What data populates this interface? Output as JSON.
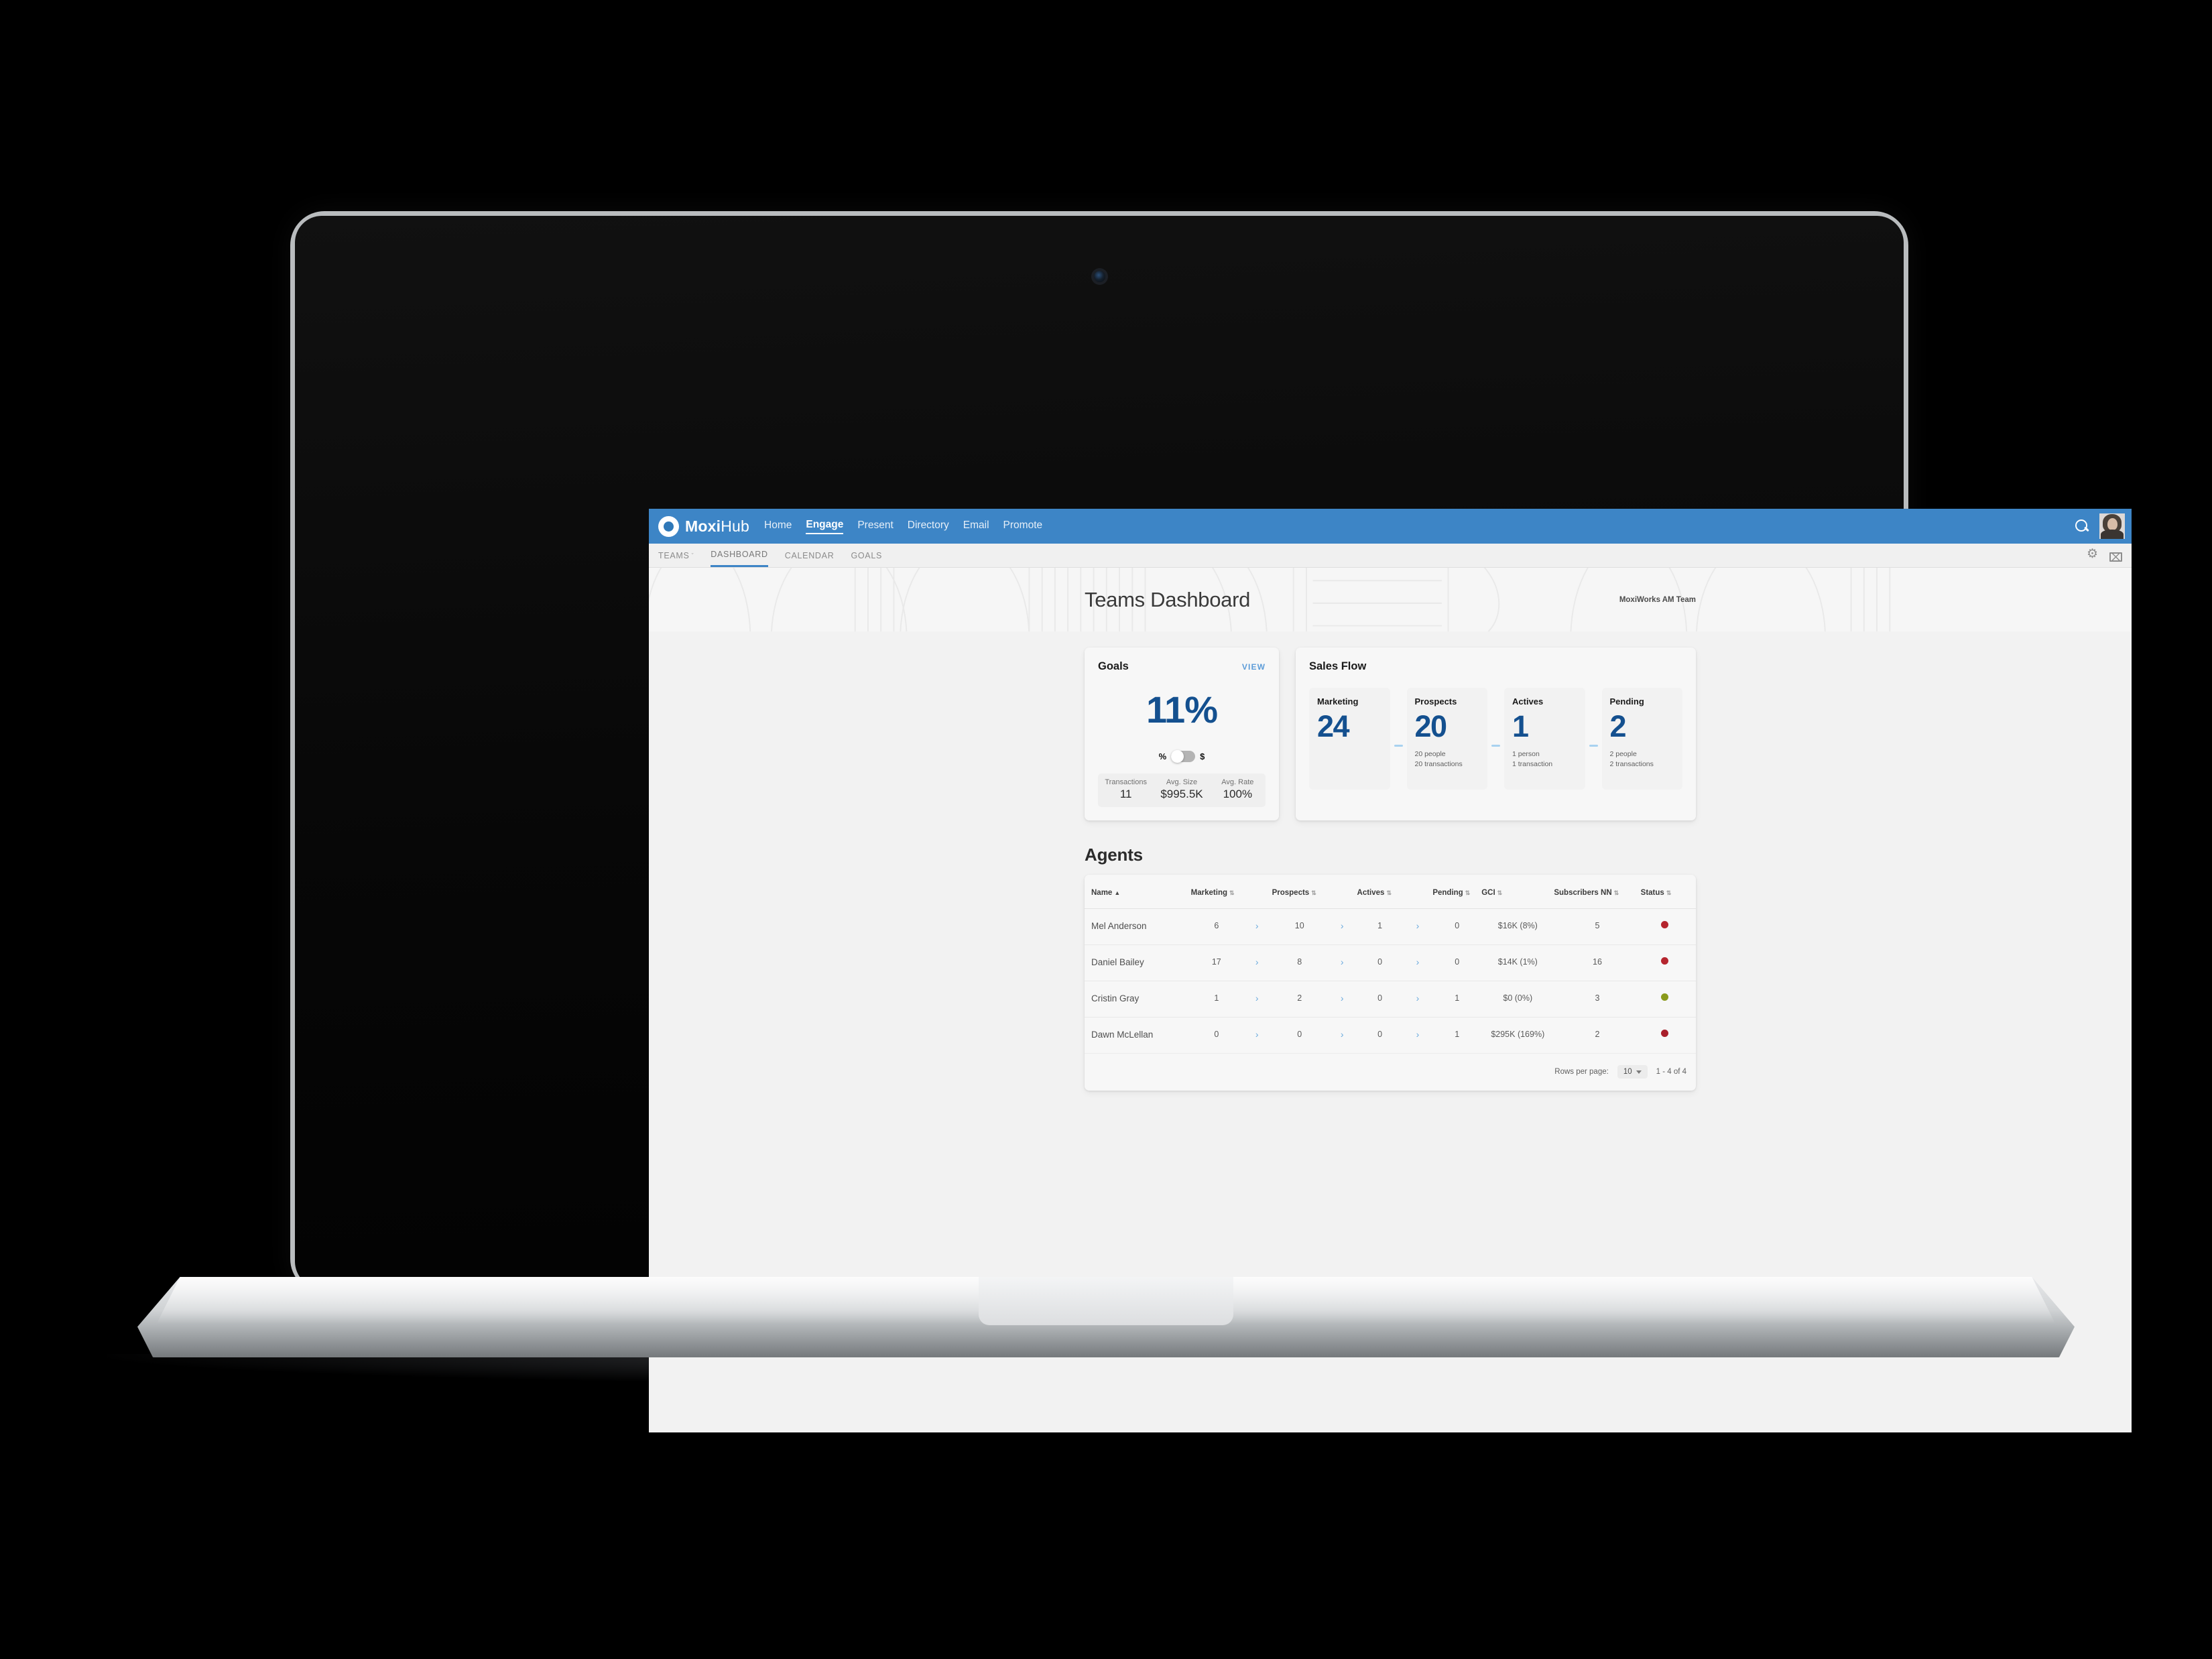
{
  "brand": {
    "name_bold": "Moxi",
    "name_light": "Hub",
    "logo_icon": "moxi-ring-logo"
  },
  "topnav": {
    "items": [
      {
        "label": "Home",
        "active": false
      },
      {
        "label": "Engage",
        "active": true
      },
      {
        "label": "Present",
        "active": false
      },
      {
        "label": "Directory",
        "active": false
      },
      {
        "label": "Email",
        "active": false
      },
      {
        "label": "Promote",
        "active": false
      }
    ],
    "search_icon": "search-icon",
    "avatar_alt": "user-avatar"
  },
  "subnav": {
    "items": [
      {
        "label": "TEAMS",
        "caret": "ˇ",
        "active": false
      },
      {
        "label": "DASHBOARD",
        "active": true
      },
      {
        "label": "CALENDAR",
        "active": false
      },
      {
        "label": "GOALS",
        "active": false
      }
    ],
    "gear_icon": "gear-icon",
    "mail_icon": "mail-icon"
  },
  "hero": {
    "title": "Teams Dashboard",
    "team": "MoxiWorks AM Team"
  },
  "goals": {
    "title": "Goals",
    "view_label": "VIEW",
    "percent": "11%",
    "toggle_left": "%",
    "toggle_right": "$",
    "stats": [
      {
        "label": "Transactions",
        "value": "11"
      },
      {
        "label": "Avg. Size",
        "value": "$995.5K"
      },
      {
        "label": "Avg. Rate",
        "value": "100%"
      }
    ]
  },
  "sales_flow": {
    "title": "Sales Flow",
    "steps": [
      {
        "label": "Marketing",
        "number": "24",
        "line1": "",
        "line2": ""
      },
      {
        "label": "Prospects",
        "number": "20",
        "line1": "20 people",
        "line2": "20 transactions"
      },
      {
        "label": "Actives",
        "number": "1",
        "line1": "1 person",
        "line2": "1 transaction"
      },
      {
        "label": "Pending",
        "number": "2",
        "line1": "2 people",
        "line2": "2 transactions"
      }
    ]
  },
  "agents": {
    "title": "Agents",
    "columns": [
      {
        "label": "Name",
        "sort": "▲"
      },
      {
        "label": "Marketing",
        "sort": "⇅"
      },
      {
        "label": "Prospects",
        "sort": "⇅"
      },
      {
        "label": "Actives",
        "sort": "⇅"
      },
      {
        "label": "Pending",
        "sort": "⇅"
      },
      {
        "label": "GCI",
        "sort": "⇅"
      },
      {
        "label": "Subscribers NN",
        "sort": "⇅"
      },
      {
        "label": "Status",
        "sort": "⇅"
      }
    ],
    "chevron": "›",
    "rows": [
      {
        "name": "Mel Anderson",
        "marketing": "6",
        "prospects": "10",
        "actives": "1",
        "pending": "0",
        "gci": "$16K (8%)",
        "subscribers": "5",
        "status_color": "#b5252e"
      },
      {
        "name": "Daniel Bailey",
        "marketing": "17",
        "prospects": "8",
        "actives": "0",
        "pending": "0",
        "gci": "$14K (1%)",
        "subscribers": "16",
        "status_color": "#b5252e"
      },
      {
        "name": "Cristin Gray",
        "marketing": "1",
        "prospects": "2",
        "actives": "0",
        "pending": "1",
        "gci": "$0 (0%)",
        "subscribers": "3",
        "status_color": "#8a9a1b"
      },
      {
        "name": "Dawn McLellan",
        "marketing": "0",
        "prospects": "0",
        "actives": "0",
        "pending": "1",
        "gci": "$295K (169%)",
        "subscribers": "2",
        "status_color": "#a81f2b"
      }
    ],
    "footer": {
      "rows_per_page_label": "Rows per page:",
      "rows_per_page_value": "10",
      "range": "1 - 4 of 4"
    }
  },
  "colors": {
    "header_blue": "#3d85c6",
    "accent_blue": "#14508f",
    "link_blue": "#5c9cd8",
    "connector_blue": "#a8d2f0"
  }
}
